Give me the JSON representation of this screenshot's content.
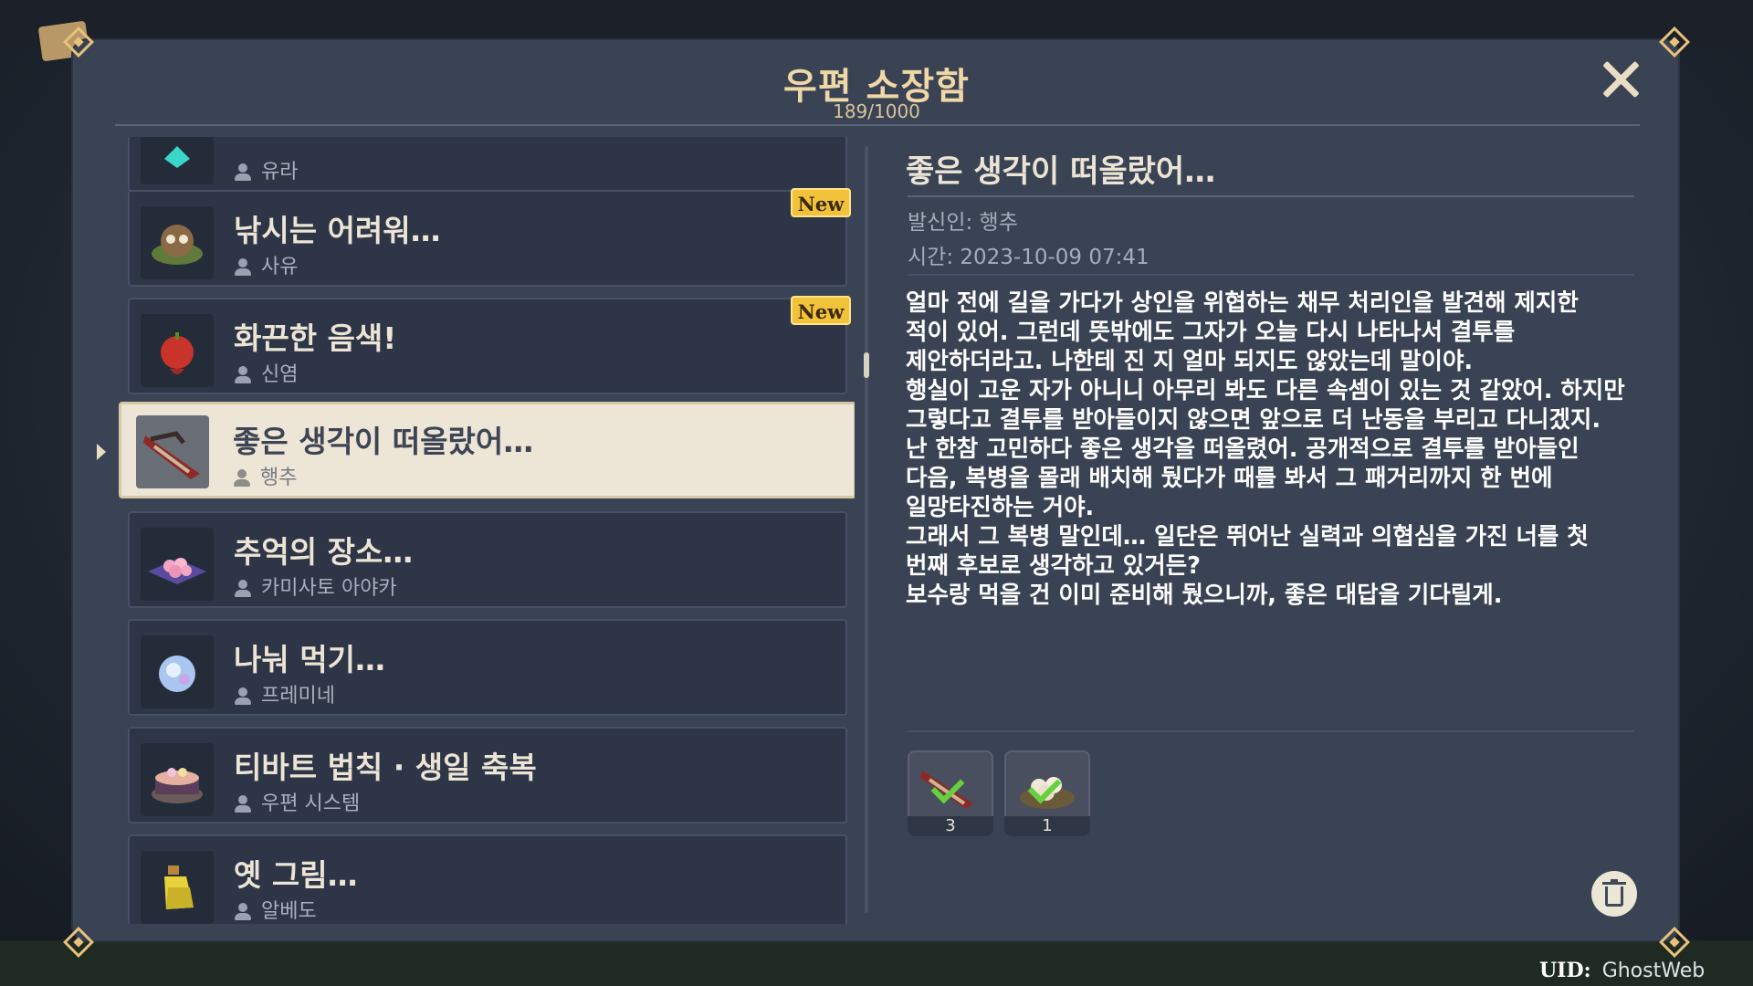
{
  "window": {
    "title": "우편 소장함",
    "count": "189/1000"
  },
  "mail_list": [
    {
      "title": "",
      "sender": "유라",
      "icon": "gem-icon",
      "new": false,
      "selected": false
    },
    {
      "title": "낚시는 어려워…",
      "sender": "사유",
      "icon": "raccoon-icon",
      "new": true,
      "selected": false
    },
    {
      "title": "화끈한 음색!",
      "sender": "신염",
      "icon": "red-fruit-icon",
      "new": true,
      "selected": false
    },
    {
      "title": "좋은 생각이 떠올랐어…",
      "sender": "행추",
      "icon": "dish-icon",
      "new": false,
      "selected": true
    },
    {
      "title": "추억의 장소…",
      "sender": "카미사토 아야카",
      "icon": "flower-tray-icon",
      "new": false,
      "selected": false
    },
    {
      "title": "나눠 먹기…",
      "sender": "프레미네",
      "icon": "crystal-icon",
      "new": false,
      "selected": false
    },
    {
      "title": "티바트 법칙 · 생일 축복",
      "sender": "우편 시스템",
      "icon": "cake-icon",
      "new": false,
      "selected": false
    },
    {
      "title": "옛 그림…",
      "sender": "알베도",
      "icon": "potion-icon",
      "new": false,
      "selected": false
    }
  ],
  "badge_new_label": "New",
  "detail": {
    "title": "좋은 생각이 떠올랐어…",
    "sender_line": "발신인: 행추",
    "time_line": "시간: 2023-10-09 07:41",
    "body": [
      "얼마 전에 길을 가다가 상인을 위협하는 채무 처리인을 발견해 제지한",
      "적이 있어. 그런데 뜻밖에도 그자가 오늘 다시 나타나서 결투를",
      "제안하더라고. 나한테 진 지 얼마 되지도 않았는데 말이야.",
      "행실이 고운 자가 아니니 아무리 봐도 다른 속셈이 있는 것 같았어. 하지만",
      "그렇다고 결투를 받아들이지 않으면 앞으로 더 난동을 부리고 다니겠지.",
      "난 한참 고민하다 좋은 생각을 떠올렸어. 공개적으로 결투를 받아들인",
      "다음, 복병을 몰래 배치해 뒀다가 때를 봐서 그 패거리까지 한 번에",
      "일망타진하는 거야.",
      "그래서 그 복병 말인데… 일단은 뛰어난 실력과 의협심을 가진 너를 첫",
      "번째 후보로 생각하고 있거든?",
      "보수랑 먹을 건 이미 준비해 뒀으니까, 좋은 대답을 기다릴게."
    ],
    "rewards": [
      {
        "qty": "3",
        "icon": "dish-icon",
        "claimed": true
      },
      {
        "qty": "1",
        "icon": "dumpling-icon",
        "claimed": true
      }
    ]
  },
  "uid": {
    "label": "UID:",
    "value": "GhostWeb"
  },
  "colors": {
    "accent_gold": "#efd7a6",
    "new_badge": "#f1c23a",
    "check_green": "#67d13d"
  }
}
